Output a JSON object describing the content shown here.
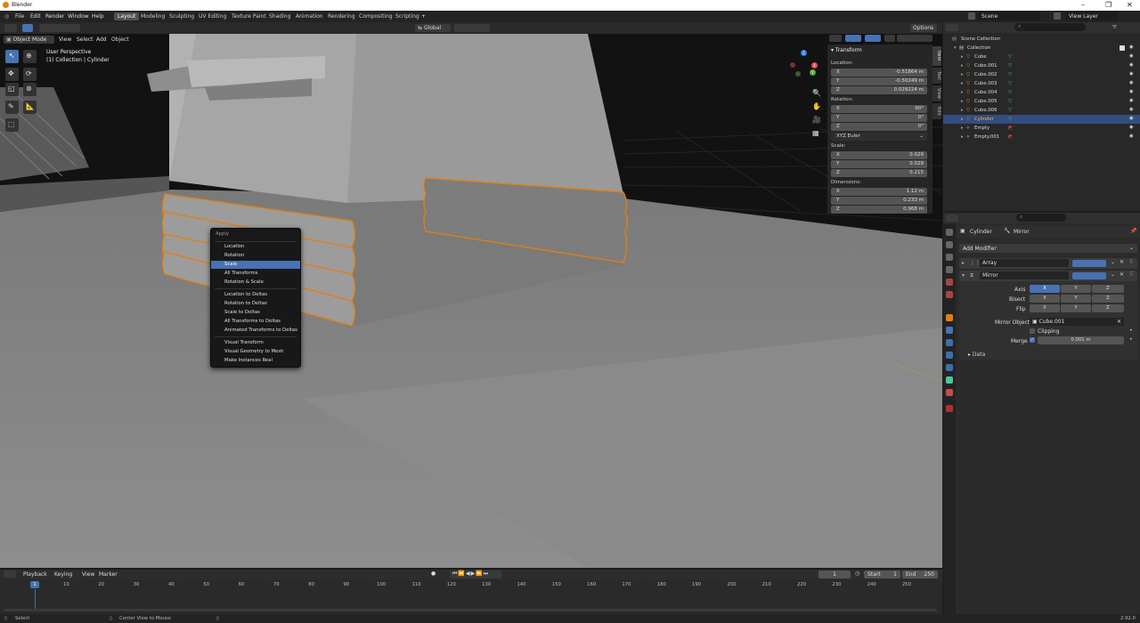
{
  "window": {
    "title": "Blender"
  },
  "menu": [
    "File",
    "Edit",
    "Render",
    "Window",
    "Help"
  ],
  "workspaces": [
    {
      "label": "Layout",
      "active": true
    },
    {
      "label": "Modeling"
    },
    {
      "label": "Sculpting"
    },
    {
      "label": "UV Editing"
    },
    {
      "label": "Texture Paint"
    },
    {
      "label": "Shading"
    },
    {
      "label": "Animation"
    },
    {
      "label": "Rendering"
    },
    {
      "label": "Compositing"
    },
    {
      "label": "Scripting"
    }
  ],
  "add_workspace": "+",
  "scene": {
    "name": "Scene",
    "view_layer": "View Layer"
  },
  "viewport_header": {
    "mode": "Object Mode",
    "menus": [
      "View",
      "Select",
      "Add",
      "Object"
    ],
    "orientation": "Global",
    "options": "Options"
  },
  "viewport_info": {
    "line1": "User Perspective",
    "line2": "(1) Collection | Cylinder"
  },
  "gizmo_axes": [
    "X",
    "Y",
    "Z"
  ],
  "npanel": {
    "section": "Transform",
    "location_label": "Location:",
    "location": [
      {
        "axis": "X",
        "value": "-0.51864 m"
      },
      {
        "axis": "Y",
        "value": "-0.50249 m"
      },
      {
        "axis": "Z",
        "value": "0.029224 m"
      }
    ],
    "rotation_label": "Rotation:",
    "rotation": [
      {
        "axis": "X",
        "value": "90°"
      },
      {
        "axis": "Y",
        "value": "0°"
      },
      {
        "axis": "Z",
        "value": "0°"
      }
    ],
    "rotation_mode": "XYZ Euler",
    "scale_label": "Scale:",
    "scale": [
      {
        "axis": "X",
        "value": "0.029"
      },
      {
        "axis": "Y",
        "value": "0.029"
      },
      {
        "axis": "Z",
        "value": "0.215"
      }
    ],
    "dimensions_label": "Dimensions:",
    "dimensions": [
      {
        "axis": "X",
        "value": "1.12 m"
      },
      {
        "axis": "Y",
        "value": "0.233 m"
      },
      {
        "axis": "Z",
        "value": "0.968 m"
      }
    ],
    "tabs": [
      "Item",
      "Tool",
      "View",
      "Edit"
    ]
  },
  "context_menu": {
    "title": "Apply",
    "groups": [
      [
        "Location",
        "Rotation",
        "Scale",
        "All Transforms",
        "Rotation & Scale"
      ],
      [
        "Location to Deltas",
        "Rotation to Deltas",
        "Scale to Deltas",
        "All Transforms to Deltas",
        "Animated Transforms to Deltas"
      ],
      [
        "Visual Transform",
        "Visual Geometry to Mesh",
        "Make Instances Real"
      ]
    ],
    "highlighted": "Scale"
  },
  "outliner": {
    "root": "Scene Collection",
    "rows": [
      {
        "name": "Collection",
        "kind": "collection"
      },
      {
        "name": "Cube",
        "kind": "mesh"
      },
      {
        "name": "Cube.001",
        "kind": "mesh"
      },
      {
        "name": "Cube.002",
        "kind": "mesh"
      },
      {
        "name": "Cube.003",
        "kind": "mesh"
      },
      {
        "name": "Cube.004",
        "kind": "mesh"
      },
      {
        "name": "Cube.005",
        "kind": "mesh"
      },
      {
        "name": "Cube.006",
        "kind": "mesh"
      },
      {
        "name": "Cylinder",
        "kind": "mesh",
        "selected": true
      },
      {
        "name": "Empty",
        "kind": "empty"
      },
      {
        "name": "Empty.001",
        "kind": "empty"
      }
    ]
  },
  "properties": {
    "object": "Cylinder",
    "modifier_context": "Mirror",
    "add_modifier": "Add Modifier",
    "modifiers": [
      {
        "name": "Array",
        "expanded": false
      },
      {
        "name": "Mirror",
        "expanded": true
      }
    ],
    "mirror": {
      "axis_label": "Axis",
      "bisect_label": "Bisect",
      "flip_label": "Flip",
      "axes": [
        "X",
        "Y",
        "Z"
      ],
      "axis_on": "X",
      "mirror_object_label": "Mirror Object",
      "mirror_object": "Cube.001",
      "clipping_label": "Clipping",
      "merge_label": "Merge",
      "merge_value": "0.001 m",
      "data_label": "Data"
    }
  },
  "timeline": {
    "menus": [
      "Playback",
      "Keying",
      "View",
      "Marker"
    ],
    "current": "1",
    "start_label": "Start",
    "start": "1",
    "end_label": "End",
    "end": "250",
    "ticks": [
      "1",
      "10",
      "20",
      "30",
      "40",
      "50",
      "60",
      "70",
      "80",
      "90",
      "100",
      "110",
      "120",
      "130",
      "140",
      "150",
      "160",
      "170",
      "180",
      "190",
      "200",
      "210",
      "220",
      "230",
      "240",
      "250"
    ]
  },
  "status": {
    "left": "Select",
    "middle": "Center View to Mouse",
    "version": "2.92.0"
  },
  "colors": {
    "accent": "#4772b3",
    "selection": "#e87d0d",
    "mesh_icon": "#e88a3a",
    "data_icon": "#4cc79a"
  }
}
